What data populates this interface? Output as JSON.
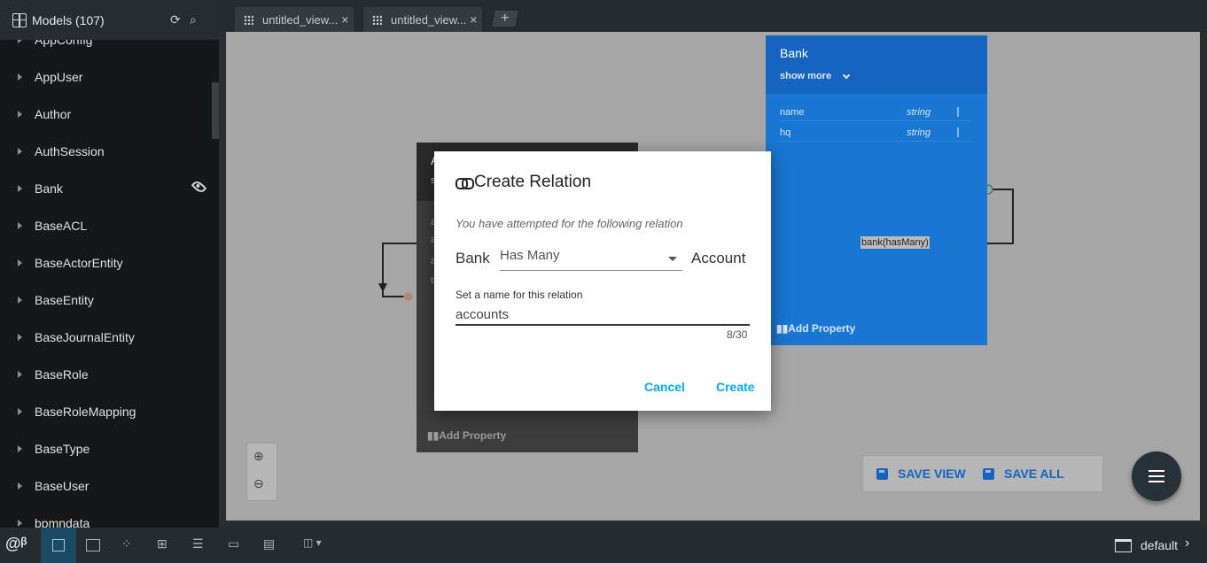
{
  "sidebar": {
    "title": "Models (107)",
    "models": [
      {
        "label": "AppConfig"
      },
      {
        "label": "AppUser"
      },
      {
        "label": "Author"
      },
      {
        "label": "AuthSession"
      },
      {
        "label": "Bank"
      },
      {
        "label": "BaseACL"
      },
      {
        "label": "BaseActorEntity"
      },
      {
        "label": "BaseEntity"
      },
      {
        "label": "BaseJournalEntity"
      },
      {
        "label": "BaseRole"
      },
      {
        "label": "BaseRoleMapping"
      },
      {
        "label": "BaseType"
      },
      {
        "label": "BaseUser"
      },
      {
        "label": "bpmndata"
      }
    ]
  },
  "tabs": [
    {
      "label": "untitled_view..."
    },
    {
      "label": "untitled_view..."
    }
  ],
  "tab_close": "×",
  "add_tab": "+",
  "canvas": {
    "account_card": {
      "title": "Ac",
      "subtitle": "sh",
      "rows": [
        "a",
        "ac",
        "a",
        "tra"
      ],
      "add_property": "Add Property"
    },
    "bank_card": {
      "title": "Bank",
      "show_more": "show more",
      "properties": [
        {
          "name": "name",
          "type": "string"
        },
        {
          "name": "hq",
          "type": "string"
        }
      ],
      "add_property": "Add Property"
    },
    "relation_label": "bank(hasMany)",
    "save_view": "SAVE VIEW",
    "save_all": "SAVE ALL"
  },
  "dialog": {
    "title": "Create Relation",
    "description": "You have attempted for the following relation",
    "from_model": "Bank",
    "relation_type": "Has Many",
    "to_model": "Account",
    "name_label": "Set a name for this relation",
    "name_value": "accounts",
    "counter": "8/30",
    "cancel": "Cancel",
    "create": "Create"
  },
  "bottombar": {
    "workspace": "default"
  }
}
